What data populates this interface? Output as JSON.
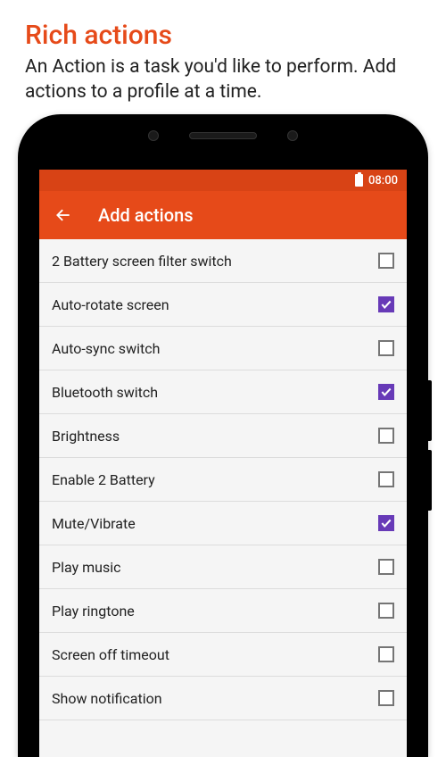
{
  "page": {
    "title": "Rich actions",
    "subtitle": "An Action is a task you'd like to perform. Add actions to a profile at a time."
  },
  "status_bar": {
    "time": "08:00"
  },
  "app_bar": {
    "title": "Add actions"
  },
  "actions": [
    {
      "label": "2 Battery screen filter switch",
      "checked": false
    },
    {
      "label": "Auto-rotate screen",
      "checked": true
    },
    {
      "label": "Auto-sync switch",
      "checked": false
    },
    {
      "label": "Bluetooth switch",
      "checked": true
    },
    {
      "label": "Brightness",
      "checked": false
    },
    {
      "label": "Enable 2 Battery",
      "checked": false
    },
    {
      "label": "Mute/Vibrate",
      "checked": true
    },
    {
      "label": "Play music",
      "checked": false
    },
    {
      "label": "Play ringtone",
      "checked": false
    },
    {
      "label": "Screen off timeout",
      "checked": false
    },
    {
      "label": "Show notification",
      "checked": false
    }
  ],
  "colors": {
    "accent": "#e64a19",
    "accent_dark": "#d84315",
    "checkbox_checked": "#673ab7"
  }
}
